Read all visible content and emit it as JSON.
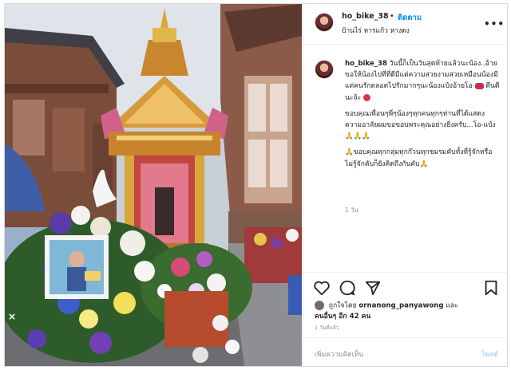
{
  "post": {
    "username": "ho_bike_38",
    "separator": "•",
    "follow_label": "ติดตาม",
    "location": "บ้านไร่ หารแก้ว หางดง",
    "more_label": "•••"
  },
  "caption": {
    "username": "ho_bike_38",
    "paragraph1": "วันนี้ก็เป็นวันสุดท้ายแล้วนะน้อง..อ้ายขอให้น้องไปที่ที่ดีมีแต่ความสวยงามสวยเหมือนน้องมีแต่คนรักตลอดไปรักมากๆนะน้องแป๋งอ้ายโอ",
    "paragraph1_tail": "คืนดีนะจ้ะ",
    "paragraph2": "ขอบคุณเพื่อนๆพี่ๆน้องๆทุกคนทุกๆท่านที่ได้แสดงความอาลัยผมขอขอบพระคุณอย่างยิ่งครับ...โอ-แป๋ง 🙏🙏🙏",
    "paragraph3": "🙏ขอบคุณทุกกลุ่มทุกก๊วนทุกชมรมคับทั้งที่รู้จักหรือไม่รู้จักคับก็ยังคิดถึงกันคับ🙏",
    "time_ago": "1 วัน"
  },
  "likes": {
    "prefix": "ถูกใจโดย",
    "user": "ornanong_panyawong",
    "connector": "และ",
    "others": "คนอื่นๆ อีก 42 คน"
  },
  "time_posted": "1 วันที่แล้ว",
  "comment": {
    "placeholder": "เพิ่มความคิดเห็น",
    "post_label": "โพสต์"
  },
  "photo": {
    "close_mark": "×"
  }
}
